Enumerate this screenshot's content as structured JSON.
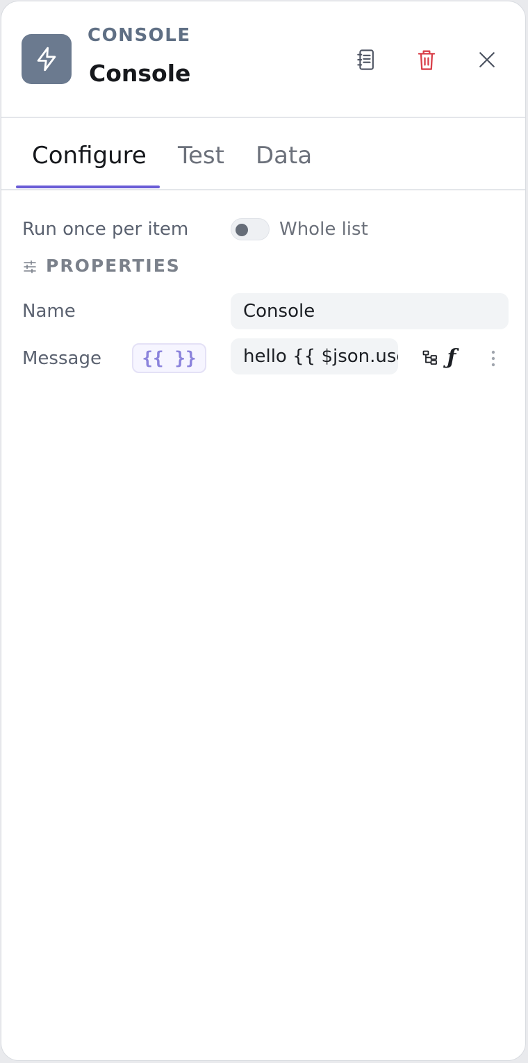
{
  "header": {
    "type_label": "CONSOLE",
    "title": "Console",
    "icon": "lightning-bolt-icon",
    "actions": {
      "notes_icon": "notebook-icon",
      "delete_icon": "trash-icon",
      "close_icon": "close-icon"
    }
  },
  "tabs": [
    {
      "label": "Configure",
      "active": true
    },
    {
      "label": "Test",
      "active": false
    },
    {
      "label": "Data",
      "active": false
    }
  ],
  "run_mode": {
    "label": "Run once per item",
    "toggle_label": "Whole list",
    "toggle_on": false
  },
  "properties": {
    "section_title": "PROPERTIES",
    "section_icon": "sliders-icon",
    "name": {
      "label": "Name",
      "value": "Console"
    },
    "message": {
      "label": "Message",
      "expression_badge": "{{ }}",
      "value": "hello {{ $json.use",
      "tree_icon": "tree-structure-icon",
      "function_icon": "function-icon",
      "more_icon": "more-vertical-icon"
    }
  },
  "colors": {
    "accent": "#6a5cd6",
    "delete": "#d9404a",
    "node_icon_bg": "#6b7a8f"
  }
}
